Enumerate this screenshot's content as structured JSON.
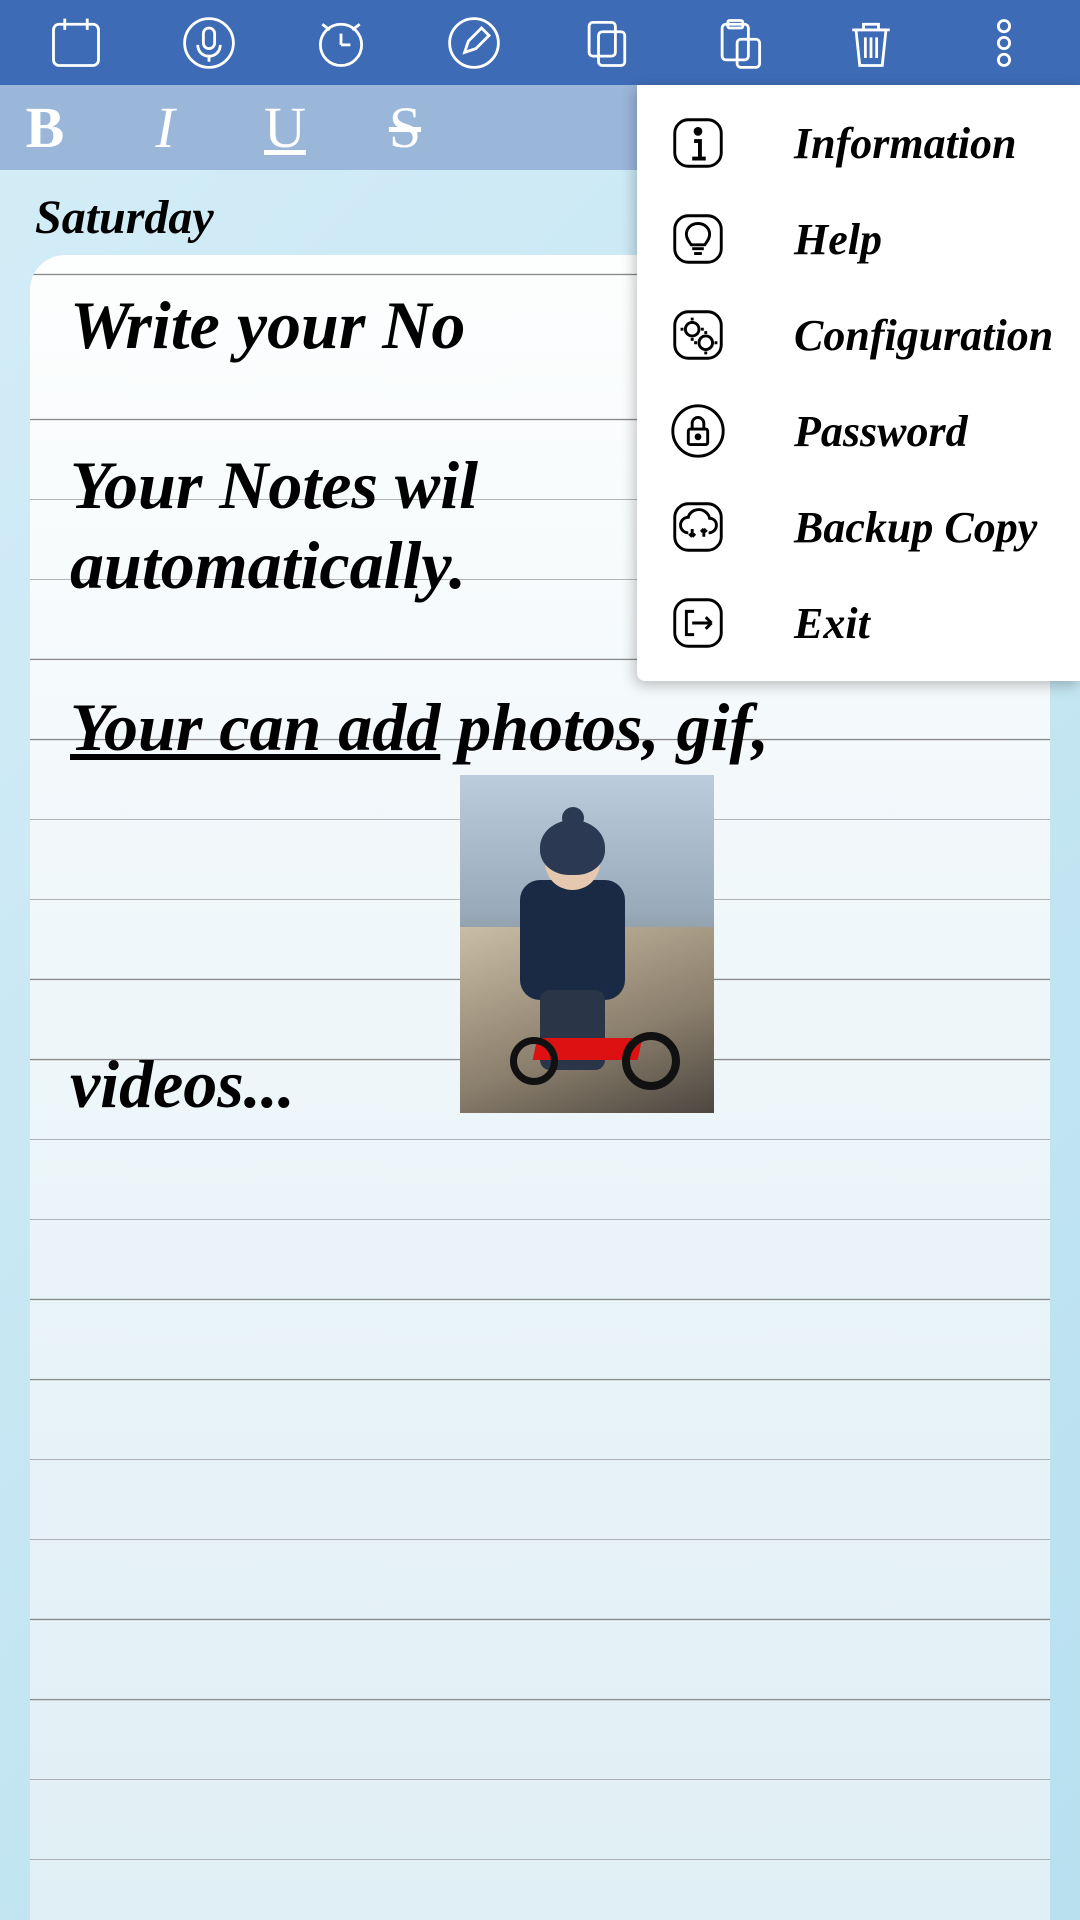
{
  "toolbar": {
    "icons": [
      "calendar",
      "mic",
      "alarm",
      "edit",
      "copy",
      "paste",
      "trash",
      "more"
    ]
  },
  "format": {
    "bold": "B",
    "italic": "I",
    "underline": "U",
    "strike": "S"
  },
  "day": "Saturday",
  "note": {
    "line1": "Write your No",
    "line2a": "Your Notes wil",
    "line2b": "automatically.",
    "line3_u": "Your can add",
    "line3_rest": " photos, gif,",
    "line4": "videos..."
  },
  "menu": {
    "items": [
      {
        "icon": "info",
        "label": "Information"
      },
      {
        "icon": "help",
        "label": "Help"
      },
      {
        "icon": "config",
        "label": "Configuration"
      },
      {
        "icon": "lock",
        "label": "Password"
      },
      {
        "icon": "cloud",
        "label": "Backup Copy"
      },
      {
        "icon": "exit",
        "label": "Exit"
      }
    ]
  }
}
